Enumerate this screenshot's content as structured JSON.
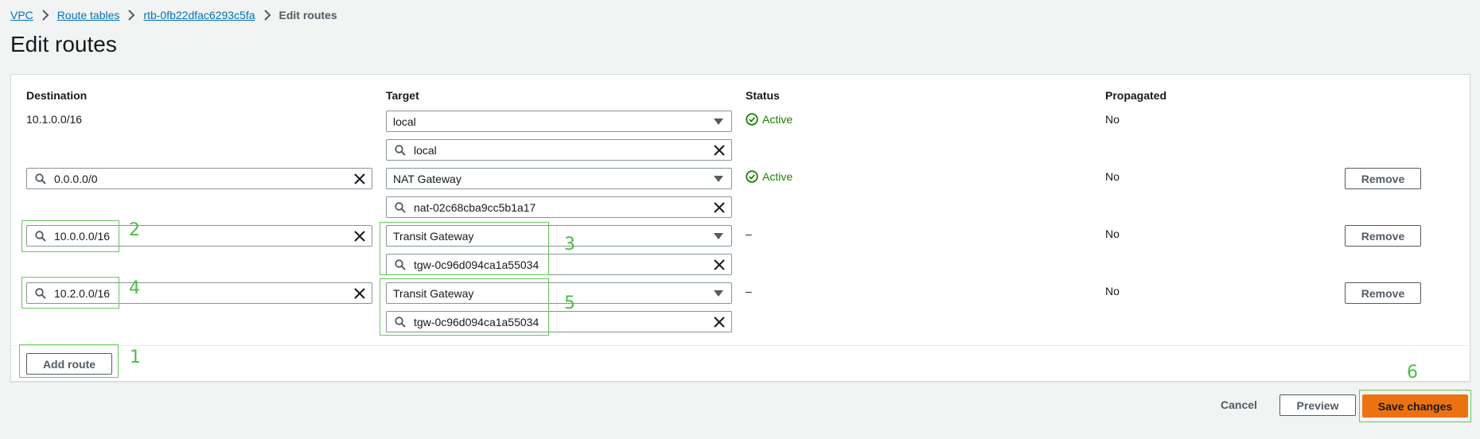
{
  "breadcrumb": {
    "items": [
      "VPC",
      "Route tables",
      "rtb-0fb22dfac6293c5fa"
    ],
    "current": "Edit routes"
  },
  "page_title": "Edit routes",
  "columns": {
    "destination": "Destination",
    "target": "Target",
    "status": "Status",
    "propagated": "Propagated"
  },
  "routes": [
    {
      "destination": "10.1.0.0/16",
      "target_type": "local",
      "target_id": "local",
      "status": "Active",
      "propagated": "No"
    },
    {
      "destination": "0.0.0.0/0",
      "target_type": "NAT Gateway",
      "target_id": "nat-02c68cba9cc5b1a17",
      "status": "Active",
      "propagated": "No",
      "remove": "Remove"
    },
    {
      "destination": "10.0.0.0/16",
      "target_type": "Transit Gateway",
      "target_id": "tgw-0c96d094ca1a55034",
      "status": "–",
      "propagated": "No",
      "remove": "Remove"
    },
    {
      "destination": "10.2.0.0/16",
      "target_type": "Transit Gateway",
      "target_id": "tgw-0c96d094ca1a55034",
      "status": "–",
      "propagated": "No",
      "remove": "Remove"
    }
  ],
  "add_route": "Add route",
  "actions": {
    "cancel": "Cancel",
    "preview": "Preview",
    "save": "Save changes"
  },
  "annotations": [
    "1",
    "2",
    "3",
    "4",
    "5",
    "6"
  ],
  "colors": {
    "link": "#0073bb",
    "status_active": "#1d8102",
    "primary": "#ec7211",
    "annotation": "#4cbf43"
  }
}
